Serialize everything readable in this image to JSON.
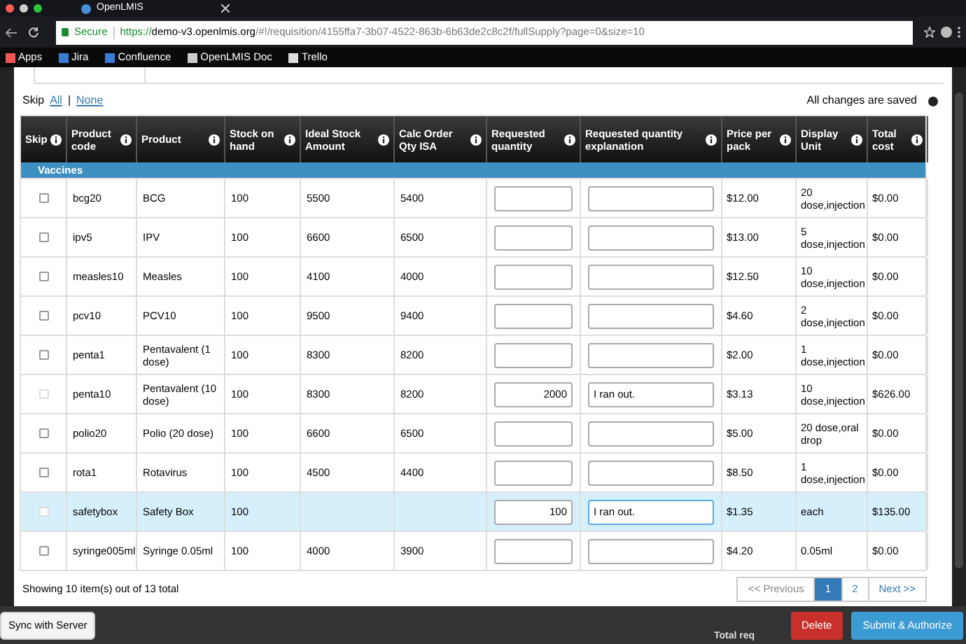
{
  "browser": {
    "tab_title": "OpenLMIS",
    "secure": "Secure",
    "url_scheme": "https://",
    "url_host": "demo-v3.openlmis.org",
    "url_path": "/#!/requisition/4155ffa7-3b07-4522-863b-6b63de2c8c2f/fullSupply?page=0&size=10",
    "bookmarks": [
      "Apps",
      "Jira",
      "Confluence",
      "OpenLMIS Doc",
      "Trello"
    ]
  },
  "toolbar": {
    "skip_label": "Skip",
    "all": "All",
    "none": "None",
    "separator": "|",
    "status": "All changes are saved"
  },
  "table": {
    "columns": [
      "Skip",
      "Product code",
      "Product",
      "Stock on hand",
      "Ideal Stock Amount",
      "Calc Order Qty ISA",
      "Requested quantity",
      "Requested quantity explanation",
      "Price per pack",
      "Display Unit",
      "Total cost"
    ],
    "category": "Vaccines",
    "rows": [
      {
        "code": "bcg20",
        "product": "BCG",
        "stock": "100",
        "ideal": "5500",
        "calc": "5400",
        "requested": "",
        "explanation": "",
        "price": "$12.00",
        "unit": "20 dose,injection",
        "total": "$0.00",
        "skip_disabled": false,
        "selected": false
      },
      {
        "code": "ipv5",
        "product": "IPV",
        "stock": "100",
        "ideal": "6600",
        "calc": "6500",
        "requested": "",
        "explanation": "",
        "price": "$13.00",
        "unit": "5 dose,injection",
        "total": "$0.00",
        "skip_disabled": false,
        "selected": false
      },
      {
        "code": "measles10",
        "product": "Measles",
        "stock": "100",
        "ideal": "4100",
        "calc": "4000",
        "requested": "",
        "explanation": "",
        "price": "$12.50",
        "unit": "10 dose,injection",
        "total": "$0.00",
        "skip_disabled": false,
        "selected": false
      },
      {
        "code": "pcv10",
        "product": "PCV10",
        "stock": "100",
        "ideal": "9500",
        "calc": "9400",
        "requested": "",
        "explanation": "",
        "price": "$4.60",
        "unit": "2 dose,injection",
        "total": "$0.00",
        "skip_disabled": false,
        "selected": false
      },
      {
        "code": "penta1",
        "product": "Pentavalent (1 dose)",
        "stock": "100",
        "ideal": "8300",
        "calc": "8200",
        "requested": "",
        "explanation": "",
        "price": "$2.00",
        "unit": "1 dose,injection",
        "total": "$0.00",
        "skip_disabled": false,
        "selected": false
      },
      {
        "code": "penta10",
        "product": "Pentavalent (10 dose)",
        "stock": "100",
        "ideal": "8300",
        "calc": "8200",
        "requested": "2000",
        "explanation": "I ran out.",
        "price": "$3.13",
        "unit": "10 dose,injection",
        "total": "$626.00",
        "skip_disabled": true,
        "selected": false
      },
      {
        "code": "polio20",
        "product": "Polio (20 dose)",
        "stock": "100",
        "ideal": "6600",
        "calc": "6500",
        "requested": "",
        "explanation": "",
        "price": "$5.00",
        "unit": "20 dose,oral drop",
        "total": "$0.00",
        "skip_disabled": false,
        "selected": false
      },
      {
        "code": "rota1",
        "product": "Rotavirus",
        "stock": "100",
        "ideal": "4500",
        "calc": "4400",
        "requested": "",
        "explanation": "",
        "price": "$8.50",
        "unit": "1 dose,injection",
        "total": "$0.00",
        "skip_disabled": false,
        "selected": false
      },
      {
        "code": "safetybox",
        "product": "Safety Box",
        "stock": "100",
        "ideal": "",
        "calc": "",
        "requested": "100",
        "explanation": "I ran out.",
        "price": "$1.35",
        "unit": "each",
        "total": "$135.00",
        "skip_disabled": true,
        "selected": true
      },
      {
        "code": "syringe005ml",
        "product": "Syringe 0.05ml",
        "stock": "100",
        "ideal": "4000",
        "calc": "3900",
        "requested": "",
        "explanation": "",
        "price": "$4.20",
        "unit": "0.05ml",
        "total": "$0.00",
        "skip_disabled": false,
        "selected": false
      }
    ]
  },
  "footer": {
    "showing": "Showing 10 item(s) out of 13 total",
    "pages": [
      {
        "label": "<< Previous",
        "selected": false,
        "disabled": true
      },
      {
        "label": "1",
        "selected": true,
        "disabled": false
      },
      {
        "label": "2",
        "selected": false,
        "disabled": false
      },
      {
        "label": "Next >>",
        "selected": false,
        "disabled": false
      }
    ]
  },
  "bottom_bar": {
    "sync": "Sync with Server",
    "total_partial": "Total req",
    "delete": "Delete",
    "submit": "Submit & Authorize"
  }
}
